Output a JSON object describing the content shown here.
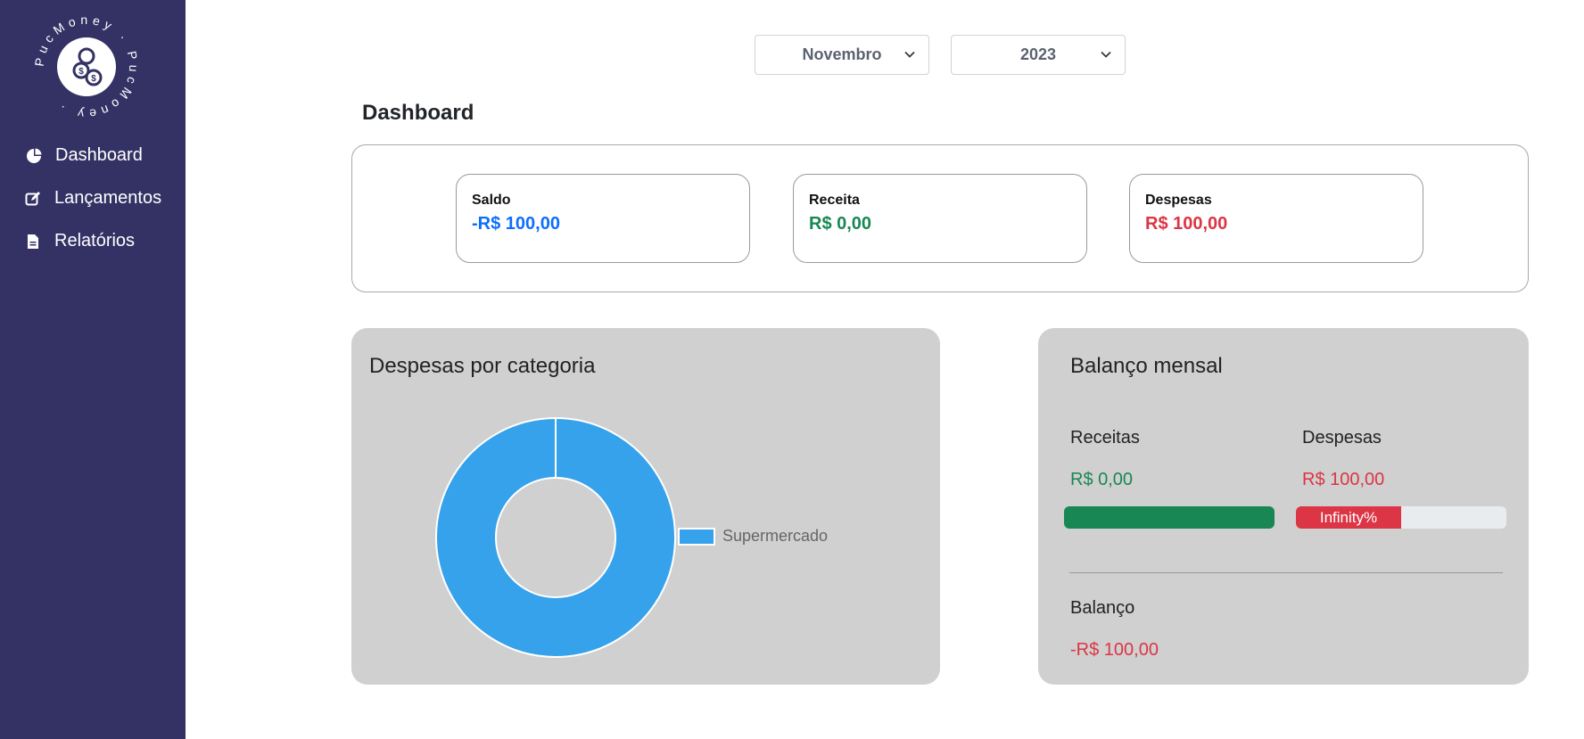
{
  "app": {
    "brand": "PucMoney"
  },
  "sidebar": {
    "items": [
      {
        "label": "Dashboard",
        "icon": "pie-chart-icon"
      },
      {
        "label": "Lançamentos",
        "icon": "edit-icon"
      },
      {
        "label": "Relatórios",
        "icon": "document-icon"
      }
    ]
  },
  "filters": {
    "month": "Novembro",
    "year": "2023"
  },
  "page": {
    "title": "Dashboard"
  },
  "summary": {
    "saldo": {
      "label": "Saldo",
      "value": "-R$ 100,00",
      "color": "#0d6efd"
    },
    "receita": {
      "label": "Receita",
      "value": "R$ 0,00",
      "color": "#198754"
    },
    "despesas": {
      "label": "Despesas",
      "value": "R$ 100,00",
      "color": "#dc3545"
    }
  },
  "expenses_chart": {
    "title": "Despesas por categoria",
    "chart_data": {
      "type": "pie",
      "categories": [
        "Supermercado"
      ],
      "values": [
        100
      ],
      "colors": [
        "#36a2eb"
      ],
      "legend": "right"
    }
  },
  "balance": {
    "title": "Balanço mensal",
    "receitas_label": "Receitas",
    "receitas_value": "R$ 0,00",
    "receitas_progress": 1.0,
    "despesas_label": "Despesas",
    "despesas_value": "R$ 100,00",
    "despesas_progress_text": "Infinity%",
    "despesas_progress": 0.5,
    "balanco_label": "Balanço",
    "balanco_value": "-R$ 100,00",
    "green": "#198754",
    "red": "#dc3545"
  }
}
